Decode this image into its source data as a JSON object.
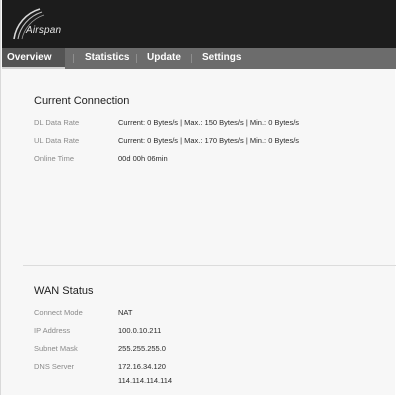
{
  "brand": {
    "logo_text": "Airspan"
  },
  "nav": {
    "tabs": [
      {
        "label": "Overview",
        "active": true
      },
      {
        "label": "Statistics",
        "active": false
      },
      {
        "label": "Update",
        "active": false
      },
      {
        "label": "Settings",
        "active": false
      }
    ]
  },
  "current_connection": {
    "title": "Current Connection",
    "rows": [
      {
        "label": "DL Data Rate",
        "value": "Current: 0 Bytes/s | Max.: 150 Bytes/s | Min.: 0 Bytes/s"
      },
      {
        "label": "UL Data Rate",
        "value": "Current: 0 Bytes/s | Max.: 170 Bytes/s | Min.: 0 Bytes/s"
      },
      {
        "label": "Online Time",
        "value": "00d 00h 06min"
      }
    ]
  },
  "wan_status": {
    "title": "WAN Status",
    "rows": [
      {
        "label": "Connect Mode",
        "value": "NAT"
      },
      {
        "label": "IP Address",
        "value": "100.0.10.211"
      },
      {
        "label": "Subnet Mask",
        "value": "255.255.255.0"
      },
      {
        "label": "DNS Server",
        "value": "172.16.34.120",
        "value2": "114.114.114.114"
      }
    ]
  },
  "colors": {
    "header_bg": "#1c1c1c",
    "nav_bg": "#6c6c6c",
    "nav_active_bg": "#545454",
    "content_bg": "#f7f7f7"
  }
}
